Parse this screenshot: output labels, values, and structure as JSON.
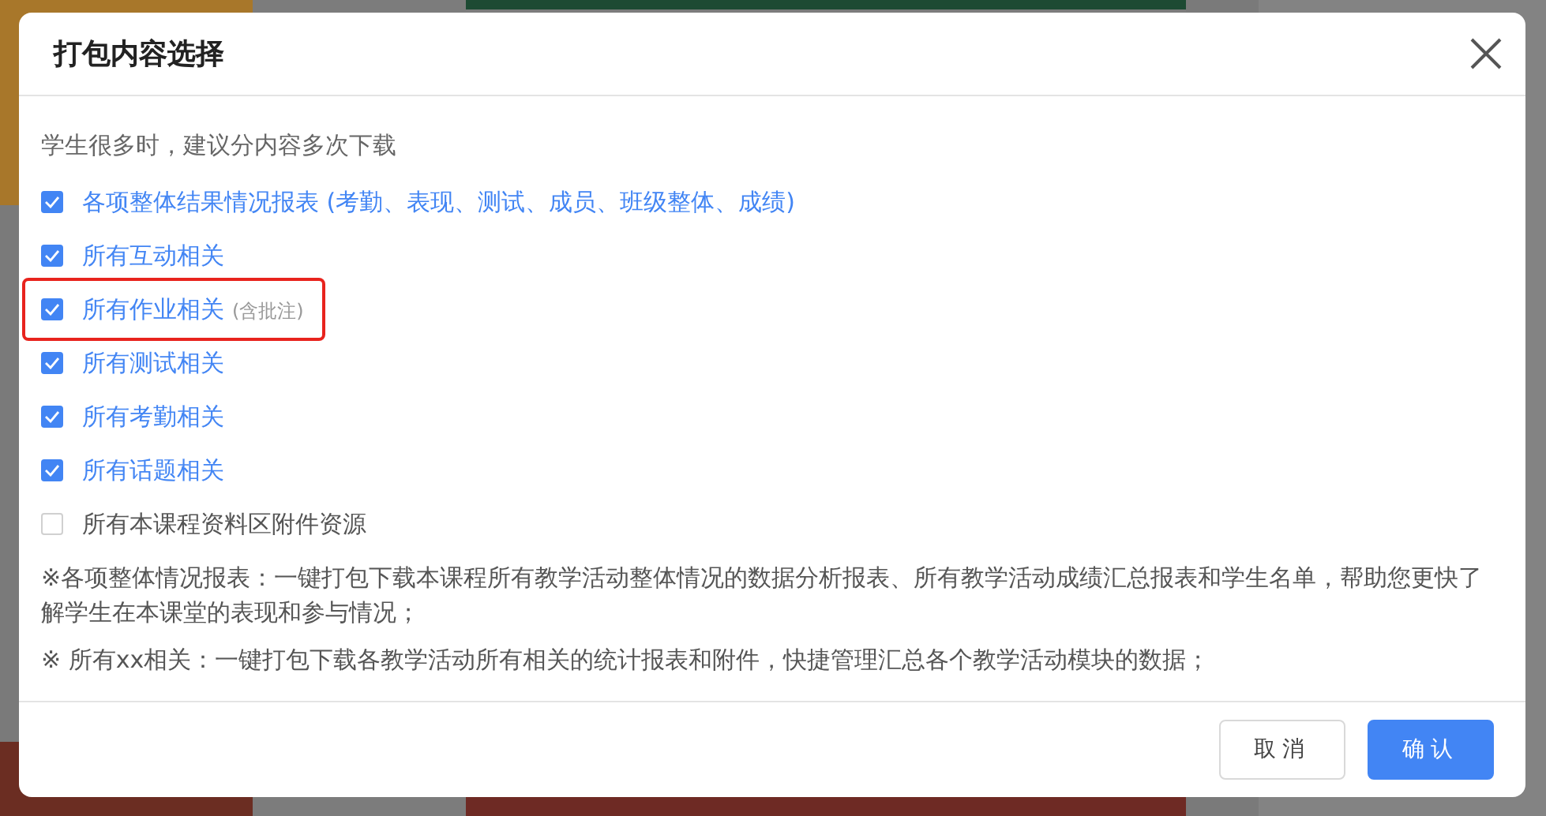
{
  "dialog": {
    "title": "打包内容选择",
    "hint": "学生很多时，建议分内容多次下载",
    "options": [
      {
        "label": "各项整体结果情况报表 (考勤、表现、测试、成员、班级整体、成绩)",
        "checked": true,
        "highlighted": false
      },
      {
        "label": "所有互动相关",
        "checked": true,
        "highlighted": false
      },
      {
        "label": "所有作业相关",
        "note": "(含批注)",
        "checked": true,
        "highlighted": true
      },
      {
        "label": "所有测试相关",
        "checked": true,
        "highlighted": false
      },
      {
        "label": "所有考勤相关",
        "checked": true,
        "highlighted": false
      },
      {
        "label": "所有话题相关",
        "checked": true,
        "highlighted": false
      },
      {
        "label": "所有本课程资料区附件资源",
        "checked": false,
        "highlighted": false
      }
    ],
    "notes": [
      "※各项整体情况报表：一键打包下载本课程所有教学活动整体情况的数据分析报表、所有教学活动成绩汇总报表和学生名单，帮助您更快了解学生在本课堂的表现和参与情况；",
      "※ 所有xx相关：一键打包下载各教学活动所有相关的统计报表和附件，快捷管理汇总各个教学活动模块的数据；"
    ],
    "buttons": [
      {
        "label": "取消",
        "kind": "secondary"
      },
      {
        "label": "确认",
        "kind": "primary"
      }
    ]
  }
}
